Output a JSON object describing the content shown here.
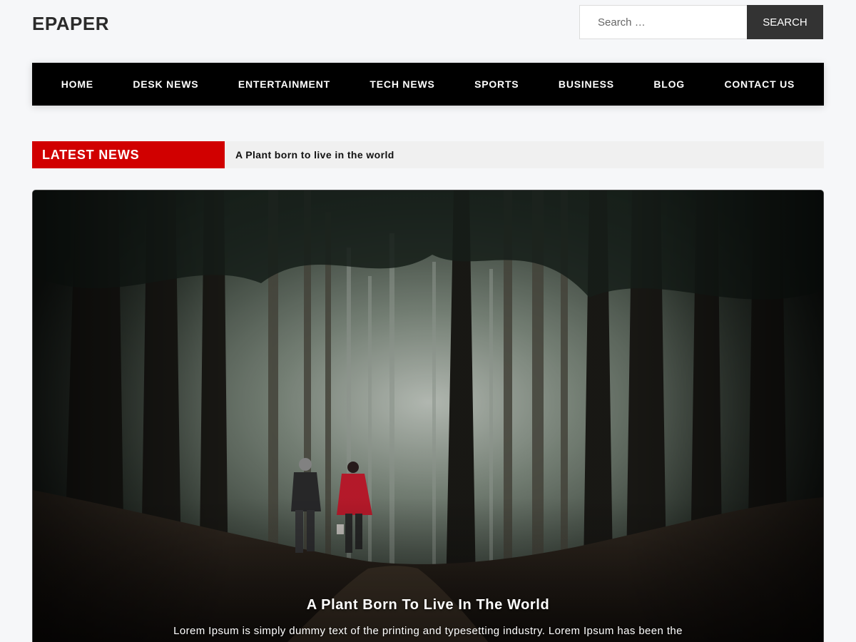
{
  "site": {
    "title": "EPAPER"
  },
  "search": {
    "placeholder": "Search …",
    "button_label": "SEARCH"
  },
  "nav": {
    "items": [
      {
        "label": "HOME"
      },
      {
        "label": "DESK NEWS"
      },
      {
        "label": "ENTERTAINMENT"
      },
      {
        "label": "TECH NEWS"
      },
      {
        "label": "SPORTS"
      },
      {
        "label": "BUSINESS"
      },
      {
        "label": "BLOG"
      },
      {
        "label": "CONTACT US"
      }
    ]
  },
  "ticker": {
    "label": "LATEST NEWS",
    "headline": "A Plant born to live in the world"
  },
  "hero": {
    "title": "A Plant Born To Live In The World",
    "excerpt": "Lorem Ipsum is simply dummy text of the printing and typesetting industry. Lorem Ipsum has been the"
  },
  "colors": {
    "accent_red": "#d10000",
    "nav_background": "#000000",
    "search_button": "#333333",
    "page_background": "#f6f7f9"
  }
}
